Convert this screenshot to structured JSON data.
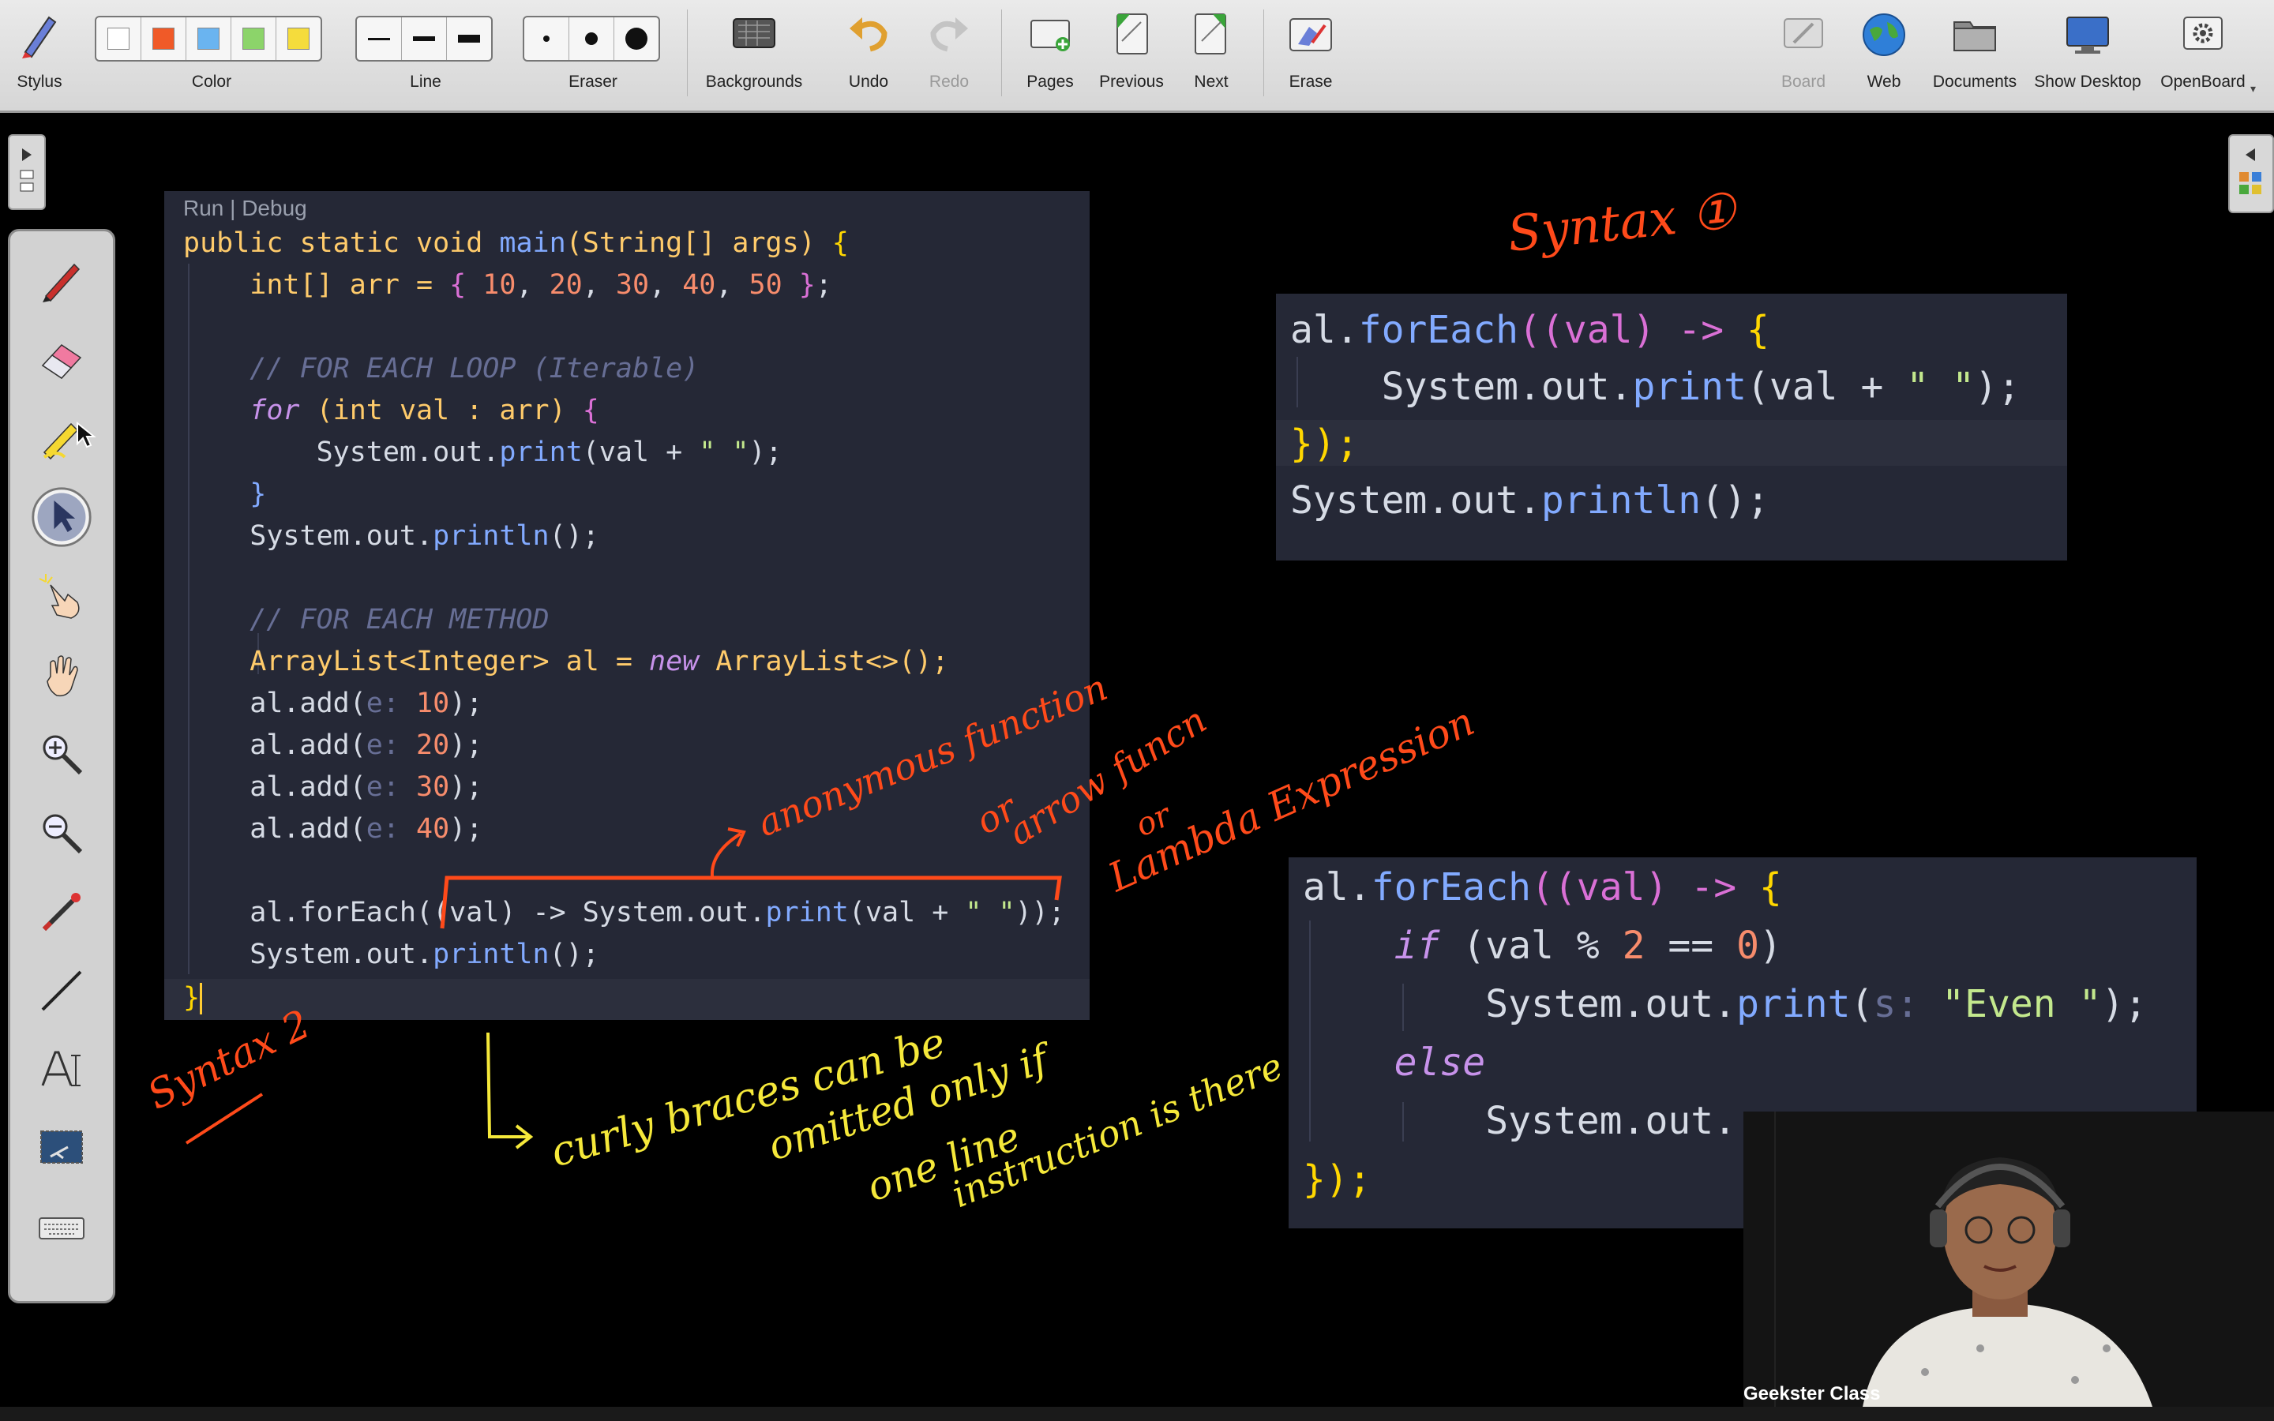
{
  "toolbar": {
    "stylus": "Stylus",
    "color": "Color",
    "line": "Line",
    "eraser": "Eraser",
    "backgrounds": "Backgrounds",
    "undo": "Undo",
    "redo": "Redo",
    "pages": "Pages",
    "previous": "Previous",
    "next": "Next",
    "erase": "Erase",
    "board": "Board",
    "web": "Web",
    "documents": "Documents",
    "show_desktop": "Show Desktop",
    "openboard": "OpenBoard",
    "swatch_colors": [
      "#ffffff",
      "#f05a28",
      "#6ab4f0",
      "#8cd46a",
      "#f5dc3c"
    ]
  },
  "editor": {
    "header": "Run | Debug",
    "l1a": "public static void ",
    "l1b": "main",
    "l1c": "(String[] args) ",
    "l1d": "{",
    "l2a": "    int[] arr = ",
    "l2b": "{",
    "l2c": " 10",
    "l2d": ",",
    "l2e": " 20",
    "l2f": ",",
    "l2g": " 30",
    "l2h": ",",
    "l2i": " 40",
    "l2j": ",",
    "l2k": " 50 ",
    "l2l": "}",
    "l2m": ";",
    "l4": "    // FOR EACH LOOP (Iterable)",
    "l5a": "    for",
    "l5b": " (int val : arr) ",
    "l5c": "{",
    "l6a": "        System.out.",
    "l6b": "print",
    "l6c": "(val + ",
    "l6d": "\" \"",
    "l6e": ");",
    "l7": "    }",
    "l8a": "    System.out.",
    "l8b": "println",
    "l8c": "();",
    "l10": "    // FOR EACH METHOD",
    "l11a": "    ArrayList<Integer> al = ",
    "l11b": "new",
    "l11c": " ArrayList<>();",
    "add": "    al.add(",
    "hint": "e:",
    "v1": " 10",
    "v2": " 20",
    "v3": " 30",
    "v4": " 40",
    "close": ");",
    "l17a": "    al.forEach((val) -> System.out.",
    "l17b": "print",
    "l17c": "(val + ",
    "l17d": "\" \"",
    "l17e": "));",
    "l18a": "    System.out.",
    "l18b": "println",
    "l18c": "();",
    "l19": "}"
  },
  "panel_top": {
    "l1a": "al.",
    "l1b": "forEach",
    "l1c": "((val) -> ",
    "l1d": "{",
    "l2a": "    System.out.",
    "l2b": "print",
    "l2c": "(val + ",
    "l2d": "\" \"",
    "l2e": ");",
    "l3": "});",
    "l4a": "System.out.",
    "l4b": "println",
    "l4c": "();"
  },
  "panel_bottom": {
    "l1a": "al.",
    "l1b": "forEach",
    "l1c": "((val) -> ",
    "l1d": "{",
    "l2a": "    if",
    "l2b": " (val % ",
    "l2c": "2",
    "l2d": " == ",
    "l2e": "0",
    "l2f": ")",
    "l3a": "        System.out.",
    "l3b": "print",
    "l3c": "(",
    "l3d": "s:",
    "l3e": " \"Even \"",
    "l3f": ");",
    "l4": "    else",
    "l5a": "        System.out.",
    "l6": "});"
  },
  "annotations": {
    "syntax1": "Syntax ①",
    "syntax2": "Syntax 2",
    "anon": "anonymous function",
    "or1": "or",
    "arrow": "arrow funcn",
    "or2": "or",
    "lambda": "Lambda Expression",
    "curly1": "curly braces can be",
    "curly2": "omitted only if",
    "curly3": "one line",
    "curly4": "instruction is there",
    "ink_orange": "#ff4a1a",
    "ink_yellow": "#f5e83a"
  },
  "camera": {
    "label": "Geekster Class"
  }
}
